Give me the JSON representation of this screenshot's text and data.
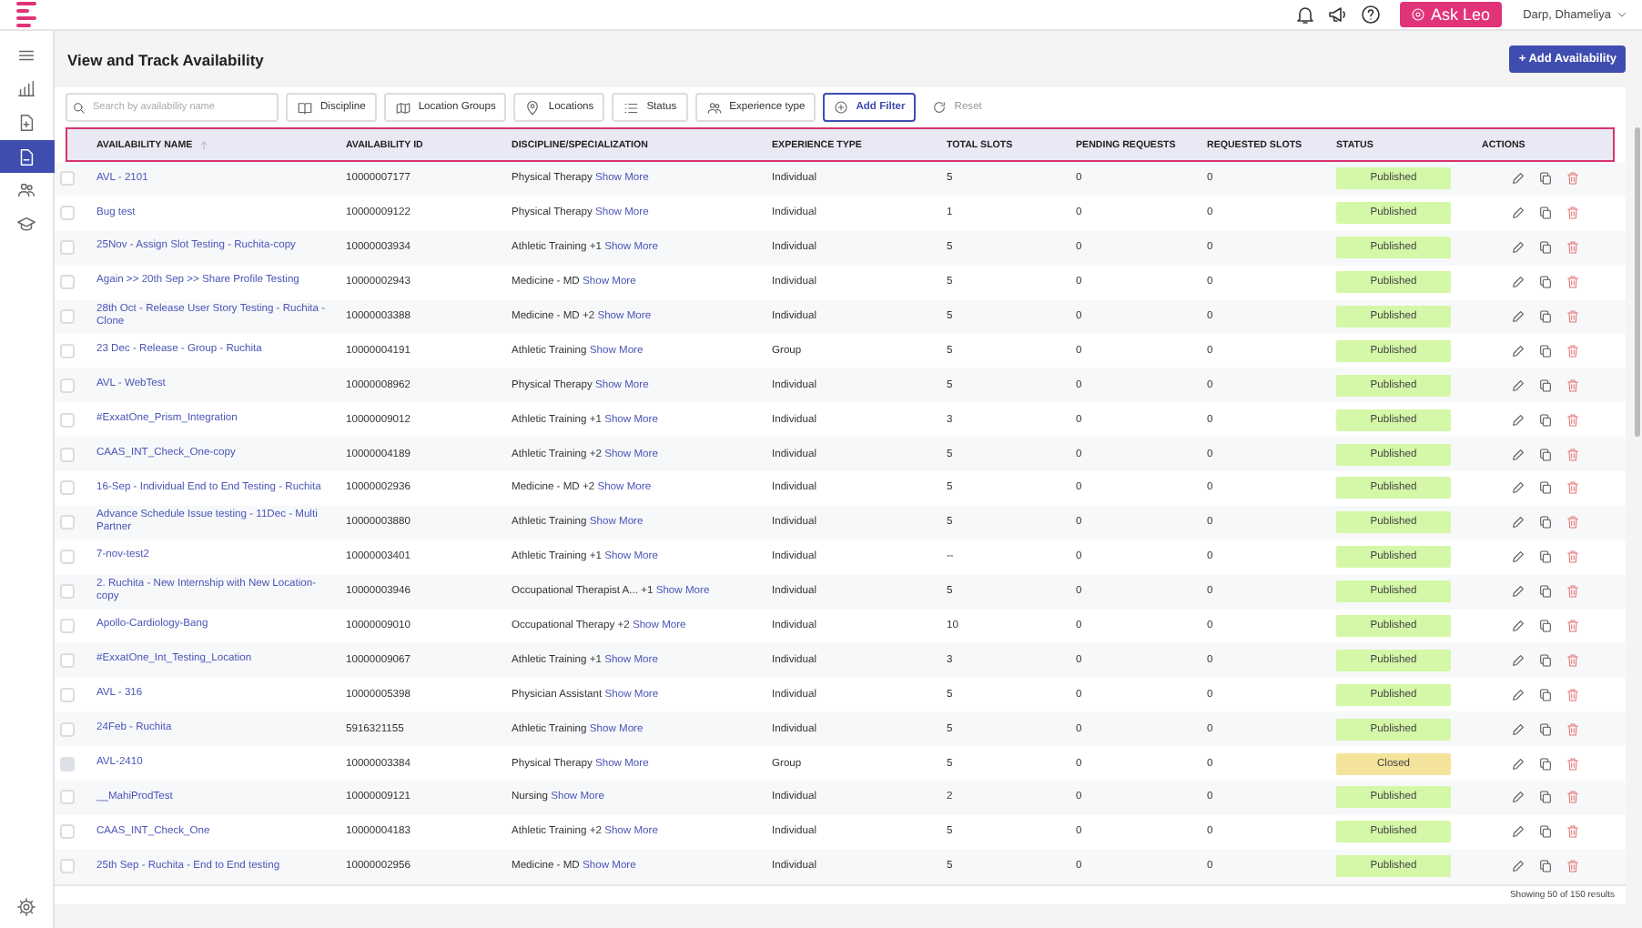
{
  "top_bar": {
    "ask_button": "Ask Leo",
    "user_name": "Darp, Dhameliya"
  },
  "sidebar": {
    "items": [
      {
        "kind": "menu",
        "selected": false
      },
      {
        "kind": "chart",
        "selected": false
      },
      {
        "kind": "doc-plus",
        "selected": false
      },
      {
        "kind": "doc",
        "selected": true
      },
      {
        "kind": "people",
        "selected": false
      },
      {
        "kind": "cap",
        "selected": false
      },
      {
        "kind": "settings",
        "selected": false
      }
    ]
  },
  "page": {
    "title": "View and Track Availability",
    "add_button": "+ Add Availability"
  },
  "filters": {
    "search": {
      "placeholder": "Search by availability name"
    },
    "chips": [
      {
        "kind": "book",
        "label": "Discipline"
      },
      {
        "kind": "map",
        "label": "Location Groups"
      },
      {
        "kind": "pin",
        "label": "Locations"
      },
      {
        "kind": "list",
        "label": "Status"
      },
      {
        "kind": "people",
        "label": "Experience type"
      }
    ],
    "add_filter": "Add Filter",
    "reset": "Reset"
  },
  "table": {
    "header_highlighted": true,
    "columns": [
      {
        "label": "AVAILABILITY NAME",
        "sortable": true
      },
      {
        "label": "AVAILABILITY ID",
        "sortable": false
      },
      {
        "label": "DISCIPLINE/SPECIALIZATION",
        "sortable": false
      },
      {
        "label": "EXPERIENCE TYPE",
        "sortable": false
      },
      {
        "label": "TOTAL SLOTS",
        "sortable": false
      },
      {
        "label": "PENDING REQUESTS",
        "sortable": false
      },
      {
        "label": "REQUESTED SLOTS",
        "sortable": false
      },
      {
        "label": "STATUS",
        "sortable": false
      },
      {
        "label": "ACTIONS",
        "sortable": false
      }
    ],
    "rows": [
      {
        "name": "AVL - 2101",
        "id": "10000007177",
        "discipline": "Physical Therapy",
        "discipline_link": "Show More",
        "experience": "Individual",
        "total_slots": "5",
        "pending_requests": "0",
        "requested_slots": "0",
        "status": "Published",
        "kind": "published",
        "checkbox_disabled": false
      },
      {
        "name": "Bug test",
        "id": "10000009122",
        "discipline": "Physical Therapy",
        "discipline_link": "Show More",
        "experience": "Individual",
        "total_slots": "1",
        "pending_requests": "0",
        "requested_slots": "0",
        "status": "Published",
        "kind": "published",
        "checkbox_disabled": false
      },
      {
        "name": "25Nov - Assign Slot Testing - Ruchita-copy",
        "id": "10000003934",
        "discipline": "Athletic Training +1",
        "discipline_link": "Show More",
        "experience": "Individual",
        "total_slots": "5",
        "pending_requests": "0",
        "requested_slots": "0",
        "status": "Published",
        "kind": "published",
        "checkbox_disabled": false
      },
      {
        "name": "Again >> 20th Sep >> Share Profile Testing",
        "id": "10000002943",
        "discipline": "Medicine - MD",
        "discipline_link": "Show More",
        "experience": "Individual",
        "total_slots": "5",
        "pending_requests": "0",
        "requested_slots": "0",
        "status": "Published",
        "kind": "published",
        "checkbox_disabled": false
      },
      {
        "name": "28th Oct - Release User Story Testing - Ruchita - Clone",
        "id": "10000003388",
        "discipline": "Medicine - MD +2",
        "discipline_link": "Show More",
        "experience": "Individual",
        "total_slots": "5",
        "pending_requests": "0",
        "requested_slots": "0",
        "status": "Published",
        "kind": "published",
        "checkbox_disabled": false
      },
      {
        "name": "23 Dec - Release - Group - Ruchita",
        "id": "10000004191",
        "discipline": "Athletic Training",
        "discipline_link": "Show More",
        "experience": "Group",
        "total_slots": "5",
        "pending_requests": "0",
        "requested_slots": "0",
        "status": "Published",
        "kind": "published",
        "checkbox_disabled": false
      },
      {
        "name": "AVL - WebTest",
        "id": "10000008962",
        "discipline": "Physical Therapy",
        "discipline_link": "Show More",
        "experience": "Individual",
        "total_slots": "5",
        "pending_requests": "0",
        "requested_slots": "0",
        "status": "Published",
        "kind": "published",
        "checkbox_disabled": false
      },
      {
        "name": "#ExxatOne_Prism_Integration",
        "id": "10000009012",
        "discipline": "Athletic Training +1",
        "discipline_link": "Show More",
        "experience": "Individual",
        "total_slots": "3",
        "pending_requests": "0",
        "requested_slots": "0",
        "status": "Published",
        "kind": "published",
        "checkbox_disabled": false
      },
      {
        "name": "CAAS_INT_Check_One-copy",
        "id": "10000004189",
        "discipline": "Athletic Training +2",
        "discipline_link": "Show More",
        "experience": "Individual",
        "total_slots": "5",
        "pending_requests": "0",
        "requested_slots": "0",
        "status": "Published",
        "kind": "published",
        "checkbox_disabled": false
      },
      {
        "name": "16-Sep - Individual End to End Testing - Ruchita",
        "id": "10000002936",
        "discipline": "Medicine - MD +2",
        "discipline_link": "Show More",
        "experience": "Individual",
        "total_slots": "5",
        "pending_requests": "0",
        "requested_slots": "0",
        "status": "Published",
        "kind": "published",
        "checkbox_disabled": false
      },
      {
        "name": "Advance Schedule Issue testing - 11Dec - Multi Partner",
        "id": "10000003880",
        "discipline": "Athletic Training",
        "discipline_link": "Show More",
        "experience": "Individual",
        "total_slots": "5",
        "pending_requests": "0",
        "requested_slots": "0",
        "status": "Published",
        "kind": "published",
        "checkbox_disabled": false
      },
      {
        "name": "7-nov-test2",
        "id": "10000003401",
        "discipline": "Athletic Training +1",
        "discipline_link": "Show More",
        "experience": "Individual",
        "total_slots": "--",
        "pending_requests": "0",
        "requested_slots": "0",
        "status": "Published",
        "kind": "published",
        "checkbox_disabled": false
      },
      {
        "name": "2. Ruchita - New Internship with New Location-copy",
        "id": "10000003946",
        "discipline": "Occupational Therapist A... +1",
        "discipline_link": "Show More",
        "experience": "Individual",
        "total_slots": "5",
        "pending_requests": "0",
        "requested_slots": "0",
        "status": "Published",
        "kind": "published",
        "checkbox_disabled": false
      },
      {
        "name": "Apollo-Cardiology-Bang",
        "id": "10000009010",
        "discipline": "Occupational Therapy +2",
        "discipline_link": "Show More",
        "experience": "Individual",
        "total_slots": "10",
        "pending_requests": "0",
        "requested_slots": "0",
        "status": "Published",
        "kind": "published",
        "checkbox_disabled": false
      },
      {
        "name": "#ExxatOne_Int_Testing_Location",
        "id": "10000009067",
        "discipline": "Athletic Training +1",
        "discipline_link": "Show More",
        "experience": "Individual",
        "total_slots": "3",
        "pending_requests": "0",
        "requested_slots": "0",
        "status": "Published",
        "kind": "published",
        "checkbox_disabled": false
      },
      {
        "name": "AVL - 316",
        "id": "10000005398",
        "discipline": "Physician Assistant",
        "discipline_link": "Show More",
        "experience": "Individual",
        "total_slots": "5",
        "pending_requests": "0",
        "requested_slots": "0",
        "status": "Published",
        "kind": "published",
        "checkbox_disabled": false
      },
      {
        "name": "24Feb - Ruchita",
        "id": "5916321155",
        "discipline": "Athletic Training",
        "discipline_link": "Show More",
        "experience": "Individual",
        "total_slots": "5",
        "pending_requests": "0",
        "requested_slots": "0",
        "status": "Published",
        "kind": "published",
        "checkbox_disabled": false
      },
      {
        "name": "AVL-2410",
        "id": "10000003384",
        "discipline": "Physical Therapy",
        "discipline_link": "Show More",
        "experience": "Group",
        "total_slots": "5",
        "pending_requests": "0",
        "requested_slots": "0",
        "status": "Closed",
        "kind": "closed",
        "checkbox_disabled": true
      },
      {
        "name": "__MahiProdTest",
        "id": "10000009121",
        "discipline": "Nursing",
        "discipline_link": "Show More",
        "experience": "Individual",
        "total_slots": "2",
        "pending_requests": "0",
        "requested_slots": "0",
        "status": "Published",
        "kind": "published",
        "checkbox_disabled": false
      },
      {
        "name": "CAAS_INT_Check_One",
        "id": "10000004183",
        "discipline": "Athletic Training +2",
        "discipline_link": "Show More",
        "experience": "Individual",
        "total_slots": "5",
        "pending_requests": "0",
        "requested_slots": "0",
        "status": "Published",
        "kind": "published",
        "checkbox_disabled": false
      },
      {
        "name": "25th Sep - Ruchita - End to End testing",
        "id": "10000002956",
        "discipline": "Medicine - MD",
        "discipline_link": "Show More",
        "experience": "Individual",
        "total_slots": "5",
        "pending_requests": "0",
        "requested_slots": "0",
        "status": "Published",
        "kind": "published",
        "checkbox_disabled": false
      }
    ],
    "footer": "Showing 50 of 150 results"
  }
}
